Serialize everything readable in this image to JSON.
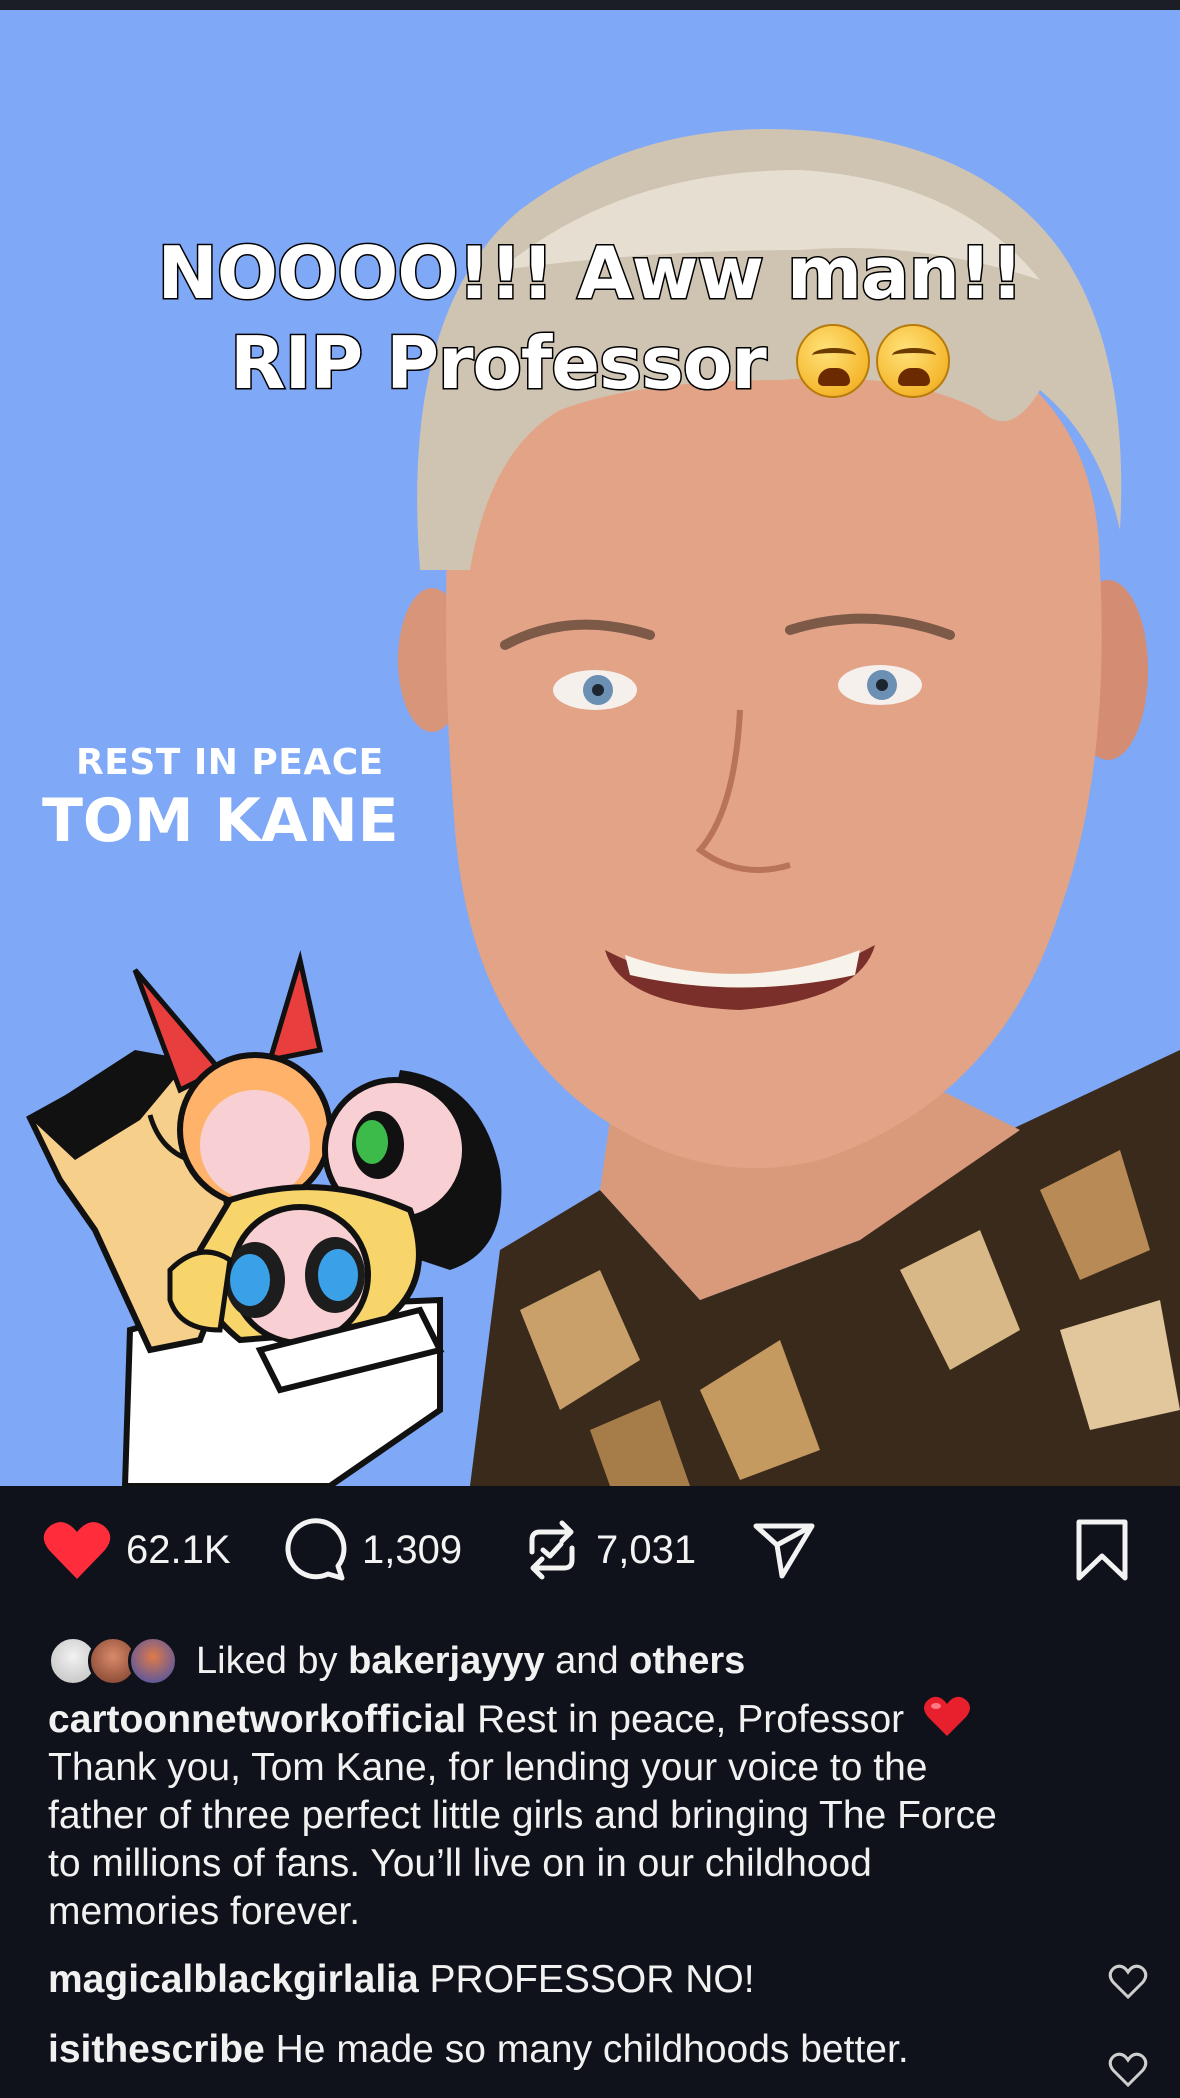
{
  "post": {
    "overlay_line1": "NOOOO!!! Aww man!!",
    "overlay_line2": "RIP Professor",
    "overlay_emoji": "weary-face-emoji x2",
    "image_text_small": "REST IN PEACE",
    "image_text_name": "TOM KANE",
    "background_color": "#7fa8f6"
  },
  "actions": {
    "likes": "62.1K",
    "comments": "1,309",
    "reposts": "7,031",
    "like_color": "#ff2d3b",
    "icons": [
      "heart-icon",
      "comment-bubble-icon",
      "repost-icon",
      "share-send-icon",
      "bookmark-icon"
    ]
  },
  "liked_by": {
    "prefix": "Liked by",
    "user": "bakerjayyy",
    "conj": "and",
    "others": "others"
  },
  "caption": {
    "username": "cartoonnetworkofficial",
    "line1": "Rest in peace, Professor",
    "line2": "Thank you, Tom Kane, for lending your voice to the",
    "line3": "father of three perfect little girls and bringing The Force",
    "line4": "to millions of fans. You’ll live on in our childhood",
    "line5": "memories forever."
  },
  "comments": [
    {
      "username": "magicalblackgirlalia",
      "text": "PROFESSOR NO!"
    },
    {
      "username": "isithescribe",
      "text": "He made so many childhoods better."
    }
  ]
}
